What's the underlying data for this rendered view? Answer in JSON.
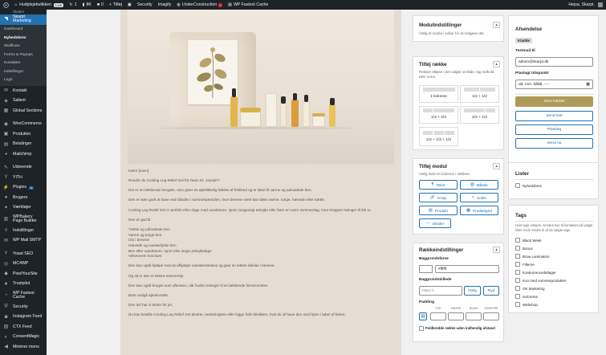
{
  "admin_bar": {
    "site_name": "Hudplejebutikken",
    "live_badge": "Live",
    "counter": "1",
    "value": "8K",
    "comments": "0",
    "new": "Tilføj",
    "security": "Security",
    "imagify": "Imagify",
    "under_construction": "UnderConstruction",
    "cache": "WP Fastest Cache",
    "greeting": "Hejsa, Skarpt."
  },
  "sidebar": {
    "top_item": "Skabel",
    "current": "Skarpt Marketing",
    "submenu": [
      "Dashboard",
      "Nyhedsbrev",
      "Mailflows",
      "Forms & Popups",
      "Kontakter",
      "Indstillinger",
      "Logs"
    ],
    "submenu_active_index": 1,
    "items": [
      {
        "label": "Kontakt",
        "icon": "envelope-icon"
      },
      {
        "label": "Salient",
        "icon": "layers-icon"
      },
      {
        "label": "Global Sections",
        "icon": "sections-icon"
      },
      {
        "label": "WooCommerce",
        "icon": "woo-icon"
      },
      {
        "label": "Produkter",
        "icon": "product-icon"
      },
      {
        "label": "Betalinger",
        "icon": "payment-icon"
      },
      {
        "label": "Mailchimp",
        "icon": "mailchimp-icon"
      },
      {
        "label": "Udseende",
        "icon": "brush-icon"
      },
      {
        "label": "YITH",
        "icon": "yith-icon"
      },
      {
        "label": "Plugins",
        "icon": "plug-icon",
        "badge": "1"
      },
      {
        "label": "Brugere",
        "icon": "users-icon"
      },
      {
        "label": "Værktøjer",
        "icon": "wrench-icon"
      },
      {
        "label": "WPBakery Page Builder",
        "icon": "builder-icon",
        "tall": true
      },
      {
        "label": "Indstillinger",
        "icon": "settings-icon"
      },
      {
        "label": "WP Mail SMTP",
        "icon": "mail-smtp-icon"
      },
      {
        "label": "Yoast SEO",
        "icon": "yoast-icon"
      },
      {
        "label": "MC4WP",
        "icon": "mc4wp-icon"
      },
      {
        "label": "PixelYourSite",
        "icon": "pixel-icon"
      },
      {
        "label": "Trustpilot",
        "icon": "star-icon"
      },
      {
        "label": "WP Fastest Cache",
        "icon": "cache-icon",
        "tall": true
      },
      {
        "label": "Security",
        "icon": "shield-icon"
      },
      {
        "label": "Instagram Feed",
        "icon": "instagram-icon"
      },
      {
        "label": "CTX Feed",
        "icon": "feed-icon"
      },
      {
        "label": "ConsentMagic",
        "icon": "consent-icon"
      },
      {
        "label": "Minimer menu",
        "icon": "collapse-icon"
      }
    ]
  },
  "email_body": {
    "paragraphs": [
      "Kære [navn]",
      "Rondér du Cooling Leg Relief Gel fra Team Dr. Joseph?",
      "Det er en lækkende bengele, som giver en øjeblikkelig følelse af friskhed og er ideel til varme og udmattede ben.",
      "Den er især godt at have ved hånden i sommerperioden, hvor benene nemt kan føles varme, tunge, hævede eller trætte.",
      "Cooling Leg Relief Gel er perfekt efter dage med vandreture, sport, langvarigt arbejde eller bare en varm sommerdag, hvor kroppen trænger til lidt ro.",
      "Den er god til:",
      "Trætte og udmattede ben\nVarme og tunge ben\nGlo i benene\nHævede og vaeskefyldte ben\nBen efter vandreture, sport eller lange arbejdsdage\nVelsevnem hos bars",
      "Den kan også hjælpe med at afhjælpe vaeskeretention og give en lettere følelse i benene.",
      "Og så er den et ekstra sommertip.",
      "Den kan også bruges som aftensen, når huden trænger til en lækkende fornemmelse.",
      "Bare undgå øjenkontakt.",
      "Den del har vi tester for jer.",
      "Du kan bestille Cooling Leg Relief Gel direkte i webshoppen eller kigge forbi klinikken, hvis du vil have den med hjem i løbet af ferien."
    ]
  },
  "modul_panel": {
    "title": "Modulindstillinger",
    "description": "Vælg et modul i editor for at redigere det."
  },
  "row_panel": {
    "title": "Tilføj række",
    "description": "Reklam ellipse i det valgte område, tag indhold eller ooroi.",
    "layouts": [
      "1 kolonne",
      "1/2 + 1/2",
      "1/3 + 2/3",
      "2/3 + 1/3",
      "1/3 + 1/3 + 1/3"
    ]
  },
  "module_panel": {
    "title": "Tilføj modul",
    "description": "Vælg først en kolonne i rækken.",
    "buttons": [
      {
        "label": "Tekst",
        "icon": "text-icon"
      },
      {
        "label": "Billede",
        "icon": "image-icon"
      },
      {
        "label": "Knap",
        "icon": "link-icon"
      },
      {
        "label": "Sokle",
        "icon": "share-icon"
      },
      {
        "label": "Produkt",
        "icon": "cart-icon"
      },
      {
        "label": "Produktgrid",
        "icon": "grid-icon"
      },
      {
        "label": "Divider",
        "icon": "minus-icon"
      }
    ]
  },
  "row_settings": {
    "title": "Rækkeindstillinger",
    "bg_color_label": "Baggrundsfarve",
    "bg_color_value": "#ffffff",
    "swatch_color": "#ffffff",
    "bg_image_label": "Baggrundsbillede",
    "bg_image_placeholder": "https://...",
    "choose_button": "Vælg",
    "remove_button": "Ryd",
    "padding_label": "Padding",
    "padding_heads": [
      "TOP",
      "HØJRE",
      "BUND",
      "VENSTRE"
    ],
    "full_width_label": "Fuldbredde række uden indhendig afstand"
  },
  "sender_panel": {
    "title": "Afsendelse",
    "status_badge": "Kladde",
    "test_label": "Testmail til",
    "test_email": "admin@skarpt.dk",
    "schedule_label": "Planlagt tidspunkt",
    "date_placeholder": "dd. mm. åååå, --:--",
    "save_draft": "Gem kladde",
    "send_test": "Send test",
    "schedule": "Planlæg",
    "send_now": "Send nu",
    "accent_color": "#b09a57"
  },
  "lists_panel": {
    "title": "Lister",
    "options": [
      "Nyhedsbrev"
    ]
  },
  "tags_panel": {
    "title": "Tags",
    "description": "Hvis tags vælges, sendes kun til kontakter på valgte lister med mindst ét af de valgte tags.",
    "options": [
      "Black Week",
      "Bonus",
      "Brow Lamination",
      "Fillerne",
      "Konkurrencedeltager",
      "Kun med sommerprodukter",
      "OK Marketing",
      "Solcreme",
      "Webshop"
    ]
  }
}
